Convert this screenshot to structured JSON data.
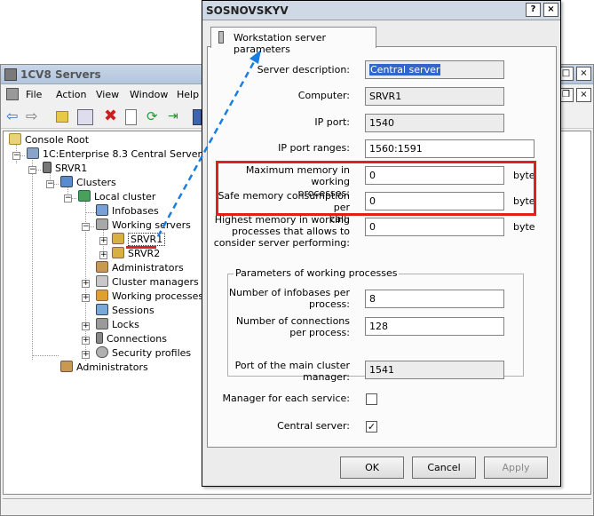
{
  "mmc": {
    "title": "1CV8 Servers",
    "menu": [
      "File",
      "Action",
      "View",
      "Window",
      "Help"
    ],
    "window_buttons": [
      "_",
      "□",
      "×"
    ]
  },
  "tree": {
    "console_root": "Console Root",
    "central_servers": "1C:Enterprise 8.3 Central Servers",
    "server": "SRVR1",
    "clusters": "Clusters",
    "local_cluster": "Local cluster",
    "infobases": "Infobases",
    "working_servers": "Working servers",
    "srvr1": "SRVR1",
    "srvr2": "SRVR2",
    "cluster_administrators": "Administrators",
    "cluster_managers": "Cluster managers",
    "working_processes": "Working processes",
    "sessions": "Sessions",
    "locks": "Locks",
    "connections": "Connections",
    "security_profiles": "Security profiles",
    "administrators": "Administrators"
  },
  "dialog": {
    "title": "SOSNOVSKYV",
    "title_buttons": [
      "?",
      "×"
    ],
    "tab_label": "Workstation server parameters",
    "labels": {
      "server_description": "Server description:",
      "computer": "Computer:",
      "ip_port": "IP port:",
      "ip_port_ranges": "IP port ranges:",
      "max_memory_1": "Maximum memory in working",
      "max_memory_2": "processes:",
      "safe_memory_1": "Safe memory consumption per",
      "safe_memory_2": "call:",
      "highest_memory_1": "Highest memory in working",
      "highest_memory_2": "processes that allows to",
      "highest_memory_3": "consider server performing:",
      "group_title": "Parameters of working processes",
      "num_infobases_1": "Number of infobases per",
      "num_infobases_2": "process:",
      "num_connections_1": "Number of connections",
      "num_connections_2": "per process:",
      "port_main_1": "Port of the main cluster",
      "port_main_2": "manager:",
      "manager_each": "Manager for each service:",
      "central_server": "Central server:"
    },
    "values": {
      "server_description": "Central server",
      "computer": "SRVR1",
      "ip_port": "1540",
      "ip_port_ranges": "1560:1591",
      "max_memory": "0",
      "safe_memory": "0",
      "highest_memory": "0",
      "num_infobases": "8",
      "num_connections": "128",
      "port_main": "1541"
    },
    "unit": "byte",
    "manager_each_checked": false,
    "central_server_checked": true,
    "checkmark": "✓",
    "buttons": {
      "ok": "OK",
      "cancel": "Cancel",
      "apply": "Apply"
    }
  },
  "colors": {
    "highlight_red": "#e0201a",
    "arrow_blue": "#1a7de0",
    "selection": "#3366cc"
  }
}
